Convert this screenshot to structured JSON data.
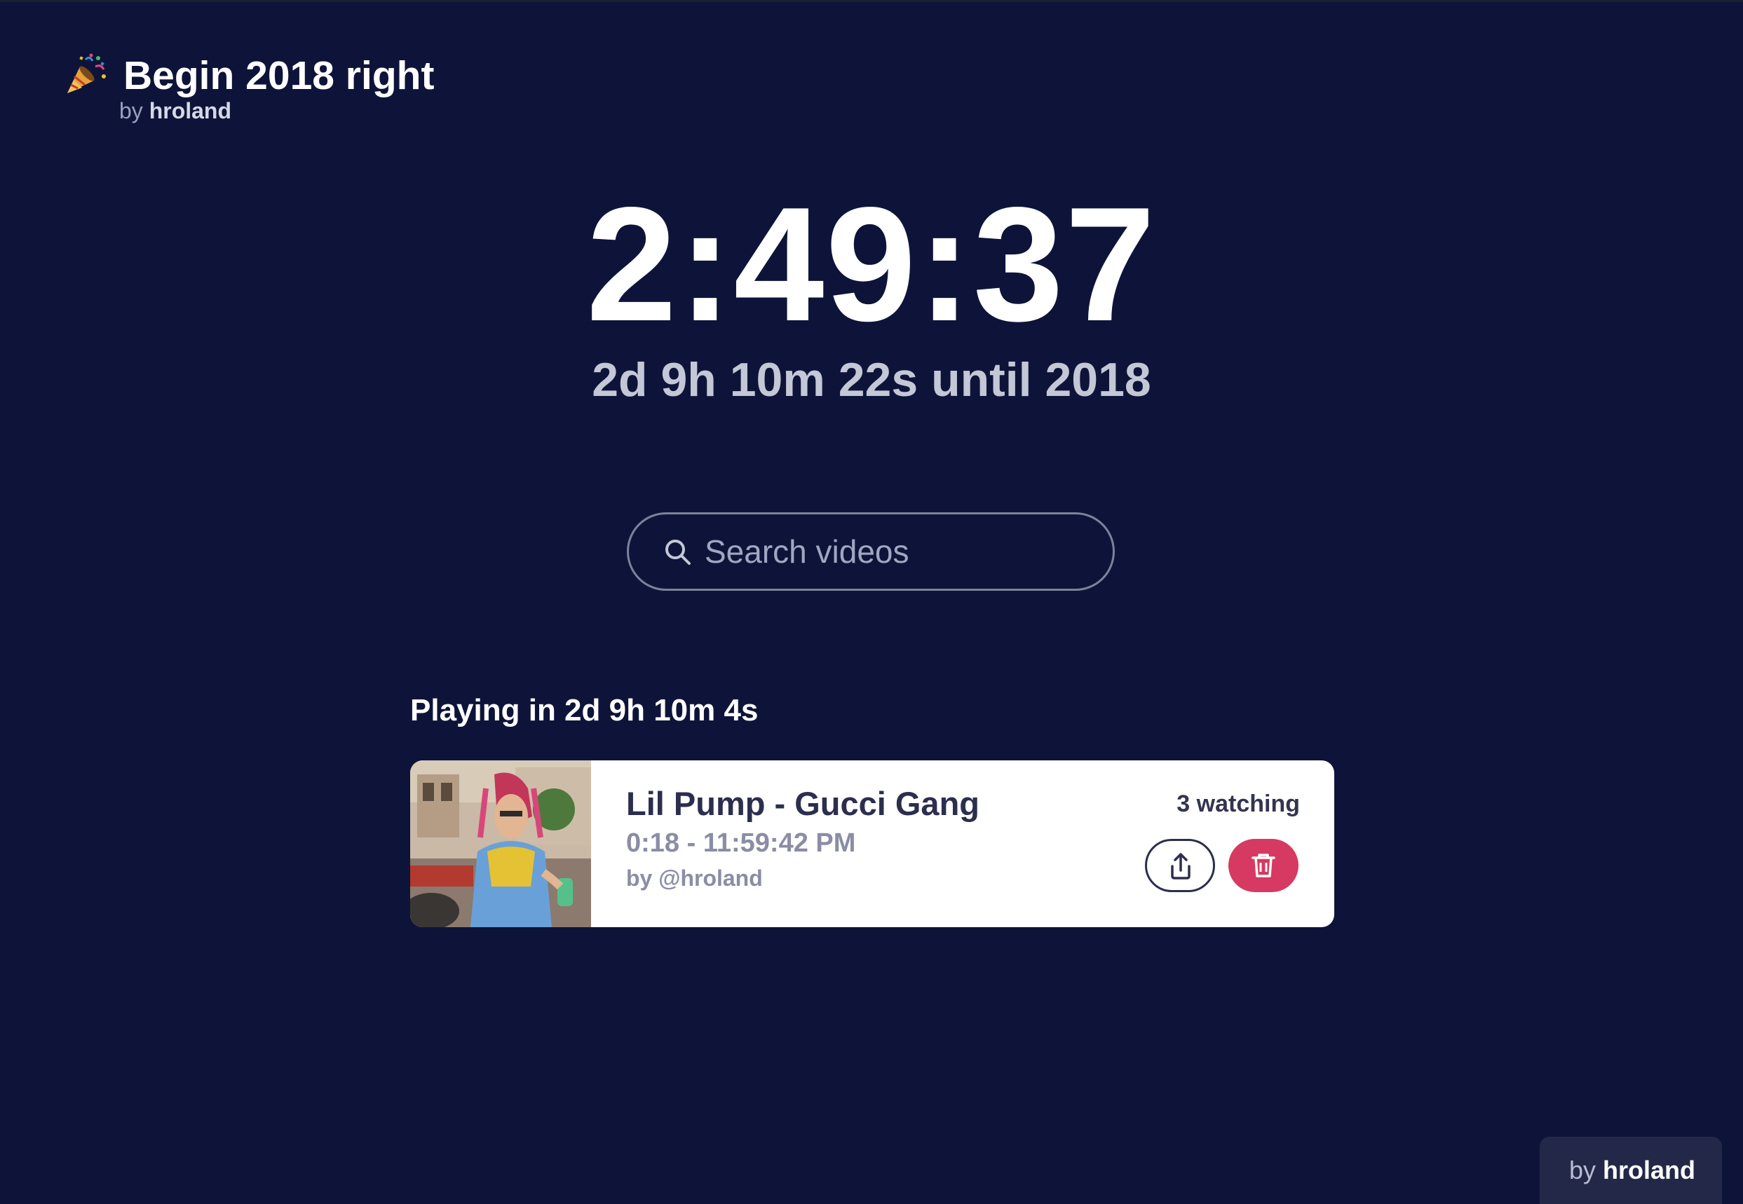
{
  "header": {
    "title": "Begin 2018 right",
    "byline_prefix": "by",
    "author": "hroland",
    "icon": "party-popper-icon"
  },
  "countdown": {
    "clock": "2:49:37",
    "until_text": "2d 9h 10m 22s until 2018"
  },
  "search": {
    "placeholder": "Search videos",
    "value": "",
    "icon": "search-icon"
  },
  "playing": {
    "heading": "Playing in 2d 9h 10m 4s",
    "videos": [
      {
        "title": "Lil Pump - Gucci Gang",
        "time_range": "0:18 - 11:59:42 PM",
        "submitter": "by @hroland",
        "watching": "3 watching",
        "share_icon": "share-icon",
        "delete_icon": "trash-icon"
      }
    ]
  },
  "footer": {
    "byline_prefix": "by",
    "author": "hroland"
  },
  "colors": {
    "background": "#0e1439",
    "card": "#ffffff",
    "delete_accent": "#d63a62",
    "primary_text_dark": "#2c2e4e"
  }
}
